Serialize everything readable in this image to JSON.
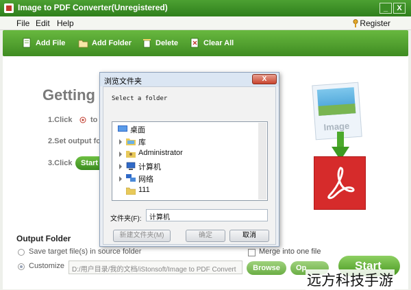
{
  "window": {
    "title": "Image to PDF Converter(Unregistered)",
    "minimize": "_",
    "close": "X"
  },
  "menu": {
    "items": [
      "File",
      "Edit",
      "Help"
    ],
    "register": "Register"
  },
  "toolbar": {
    "add_file": "Add File",
    "add_folder": "Add Folder",
    "delete": "Delete",
    "clear_all": "Clear All"
  },
  "main": {
    "heading": "Getting",
    "step1": "1.Click",
    "step1_tail": "to",
    "step2": "2.Set output fo",
    "step3": "3.Click",
    "step3_button": "Start"
  },
  "output": {
    "title": "Output Folder",
    "option_source": "Save target file(s) in source folder",
    "option_customize": "Customize",
    "path": "D:/用户目录/我的文档/iStonsoft/Image to PDF Convert",
    "browse": "Browse",
    "open": "Op",
    "merge": "Merge into one file",
    "start": "Start"
  },
  "illustration": {
    "image_label": "Image"
  },
  "dialog": {
    "title": "浏览文件夹",
    "close": "X",
    "prompt": "Select a folder",
    "tree": [
      {
        "label": "桌面",
        "icon": "desktop-icon",
        "expandable": false
      },
      {
        "label": "库",
        "icon": "library-icon",
        "expandable": true
      },
      {
        "label": "Administrator",
        "icon": "user-folder-icon",
        "expandable": true
      },
      {
        "label": "计算机",
        "icon": "computer-icon",
        "expandable": true
      },
      {
        "label": "网络",
        "icon": "network-icon",
        "expandable": true
      },
      {
        "label": "111",
        "icon": "folder-icon",
        "expandable": false
      }
    ],
    "folder_label": "文件夹(F):",
    "folder_value": "计算机",
    "new_folder": "新建文件夹(M)",
    "ok": "确定",
    "cancel": "取消"
  },
  "watermark": "远方科技手游",
  "colors": {
    "brand_green": "#3f8c22",
    "pdf_red": "#d62b2b",
    "dialog_close": "#c9442e"
  }
}
